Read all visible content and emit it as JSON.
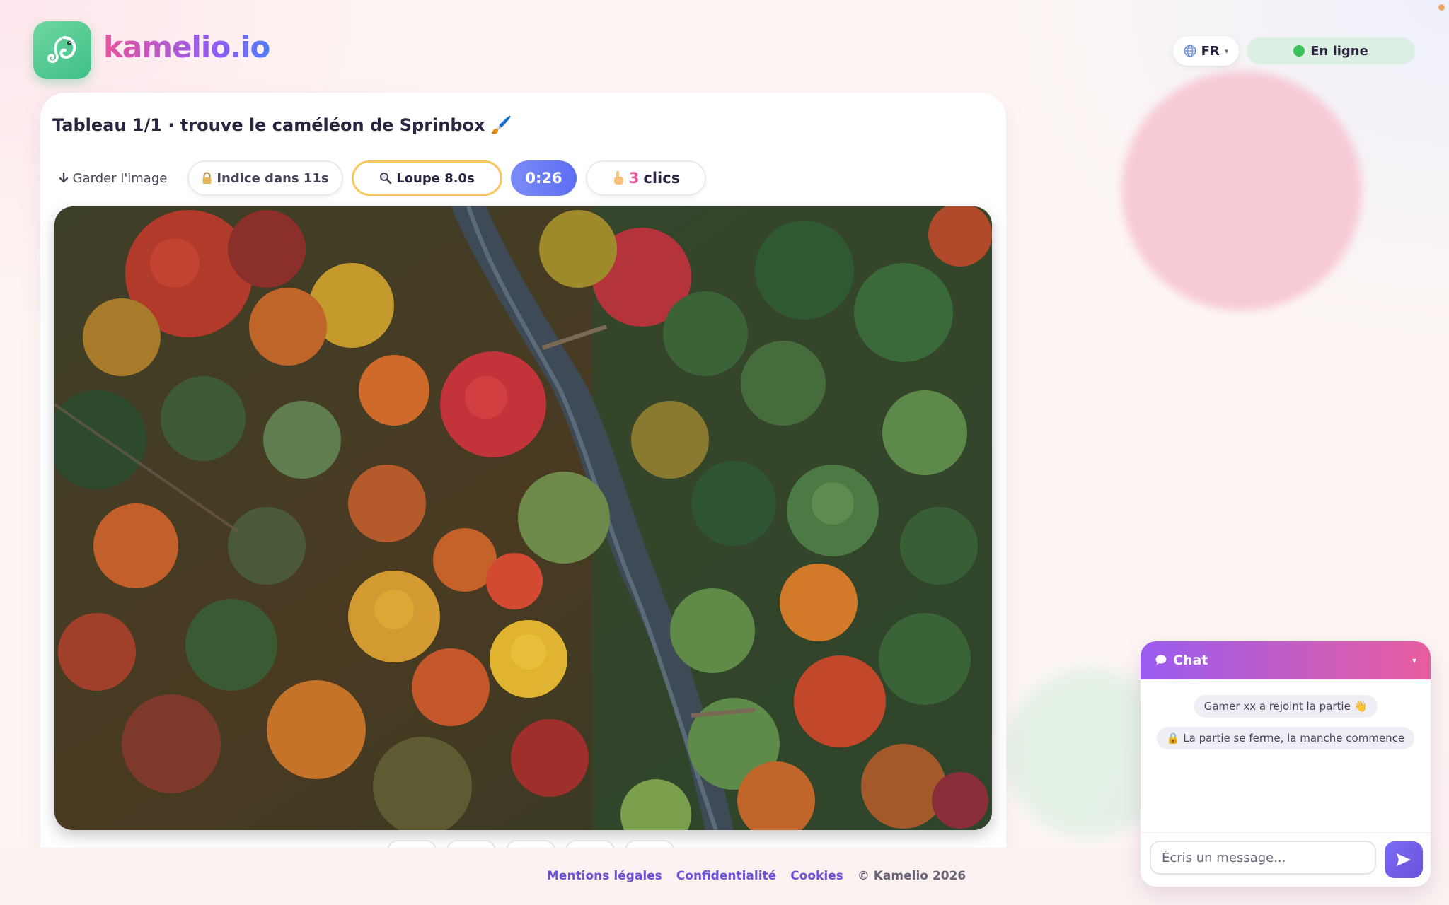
{
  "header": {
    "brand": "kamelio.io",
    "lang_label": "FR",
    "lang_caret": "▾",
    "status_label": "En ligne"
  },
  "game": {
    "title": "Tableau 1/1 · trouve le caméléon de Sprinbox 🖌️",
    "toolbar": {
      "download_label": "Garder l'image",
      "hint_label": "Indice dans 11s",
      "loupe_label": "Loupe 8.0s",
      "timer": "0:26",
      "clicks_count": "3",
      "clicks_label": "clics"
    }
  },
  "chat": {
    "title": "Chat",
    "messages": [
      "Gamer xx a rejoint la partie 👋",
      "🔒 La partie se ferme, la manche commence"
    ],
    "input_placeholder": "Écris un message..."
  },
  "footer": {
    "legal": "Mentions légales",
    "privacy": "Confidentialité",
    "cookies": "Cookies",
    "copyright": "© Kamelio 2026"
  },
  "colors": {
    "accent_purple": "#6a52d9",
    "accent_pink": "#e8559b",
    "online_green": "#3cc05a",
    "loupe_border": "#f6c65f",
    "timer_blue": "#5b6ef3"
  }
}
